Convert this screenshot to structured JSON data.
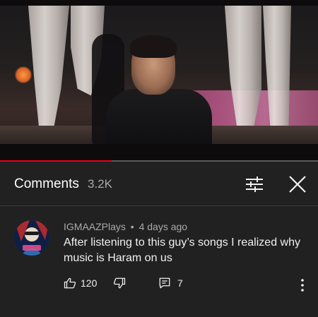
{
  "video": {
    "progress_fraction": 0.35
  },
  "comments_panel": {
    "title": "Comments",
    "count": "3.2K",
    "filter_icon": "sliders-icon",
    "close_icon": "close-icon"
  },
  "comment": {
    "author": "IGMAAZPlays",
    "separator": "•",
    "time": "4 days ago",
    "text": "After listening to this guy’s songs I realized why music is Haram on us",
    "likes": "120",
    "replies": "7",
    "like_icon": "thumbs-up-icon",
    "dislike_icon": "thumbs-down-icon",
    "reply_icon": "reply-icon",
    "more_icon": "more-vertical-icon"
  },
  "colors": {
    "background": "#212121",
    "progress": "#e3001b",
    "secondary_text": "#aaaaaa"
  }
}
